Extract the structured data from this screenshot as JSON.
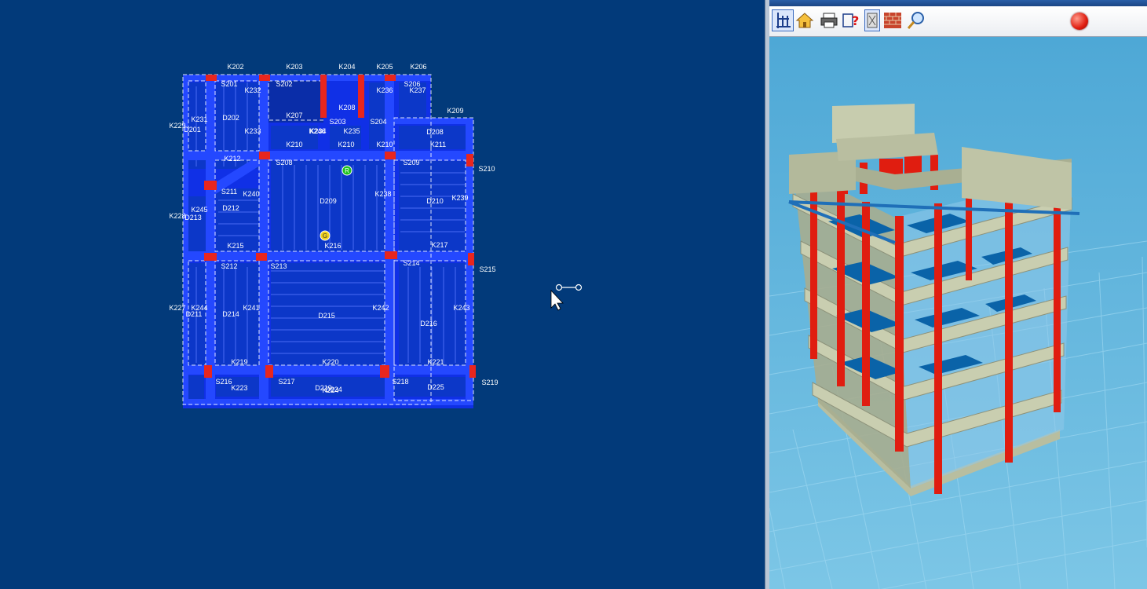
{
  "plan": {
    "beam_labels": [
      "K202",
      "K203",
      "K204",
      "K205",
      "K206",
      "K208",
      "K209",
      "K207",
      "K210",
      "K210",
      "K210",
      "K211",
      "K212",
      "K215",
      "K216",
      "K217",
      "K219",
      "K220",
      "K221",
      "K223",
      "K224",
      "K227",
      "K228",
      "K229",
      "K231",
      "K232",
      "K233",
      "K234",
      "K235",
      "K236",
      "K237",
      "K238",
      "K239",
      "K240",
      "K241",
      "K242",
      "K243",
      "K244",
      "K245",
      "K246"
    ],
    "slab_labels": [
      "S201",
      "S202",
      "S206",
      "S203",
      "S204",
      "S208",
      "S209",
      "S210",
      "S211",
      "S212",
      "S213",
      "S214",
      "S215",
      "S216",
      "S217",
      "S218",
      "S219"
    ],
    "span_labels": [
      "D202",
      "D208",
      "D209",
      "D210",
      "D212",
      "D214",
      "D215",
      "D216",
      "D219",
      "D224",
      "D225",
      "D201",
      "D211",
      "D213"
    ],
    "markers": {
      "r_label": "R",
      "g_label": "G"
    }
  },
  "viewer": {
    "toolbar_icons": [
      "axes-icon",
      "home-icon",
      "print-icon",
      "help-icon",
      "checkbox-icon",
      "wall-icon",
      "zoom-icon"
    ],
    "close_button": "close-icon",
    "colors": {
      "background": "#62b8dc",
      "column": "#e01d10",
      "slab": "#c9ceb0",
      "floor_panel": "#0a63a8"
    }
  },
  "colors": {
    "plan_bg": "#023a7a",
    "beam": "#1a3fff",
    "column": "#e8261e"
  }
}
